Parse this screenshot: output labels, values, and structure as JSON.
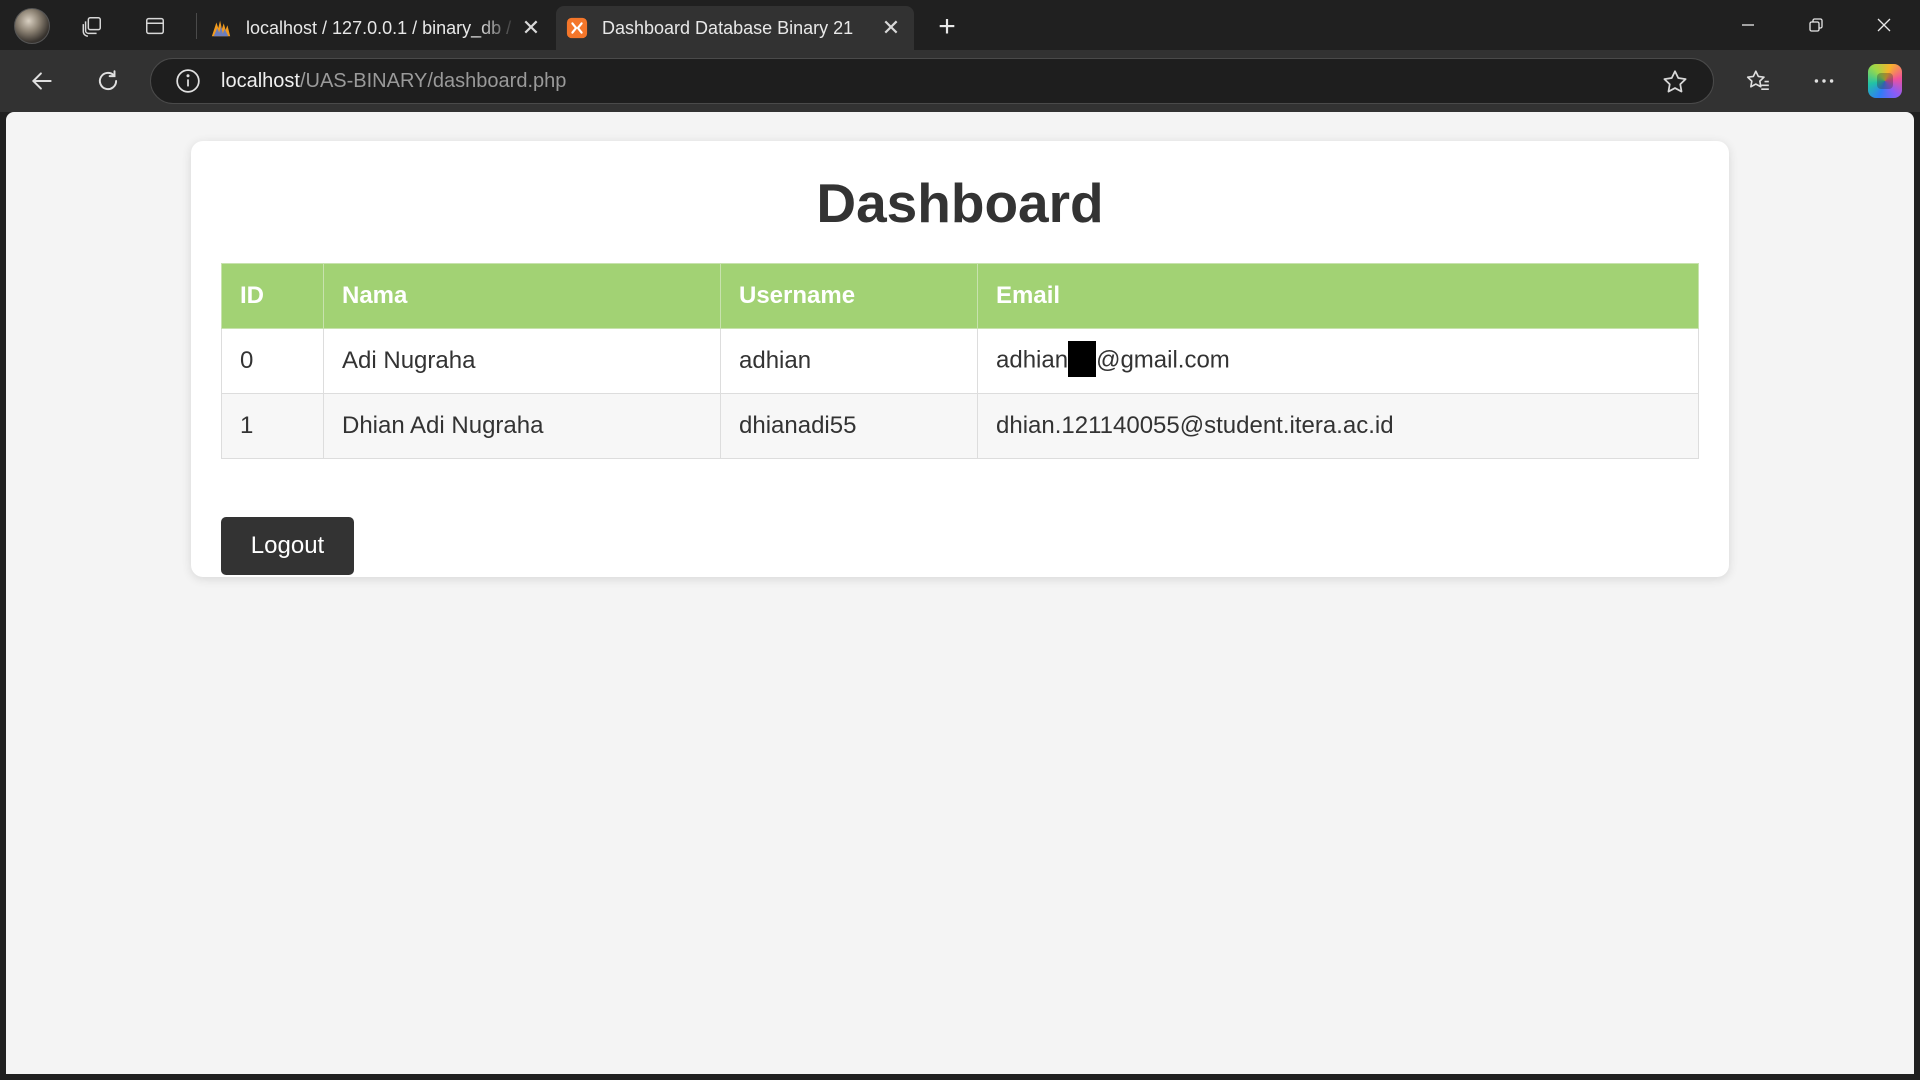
{
  "browser": {
    "tabs": [
      {
        "title": "localhost / 127.0.0.1 / binary_db / ",
        "active": false
      },
      {
        "title": "Dashboard Database Binary 21",
        "active": true
      }
    ],
    "address": {
      "host": "localhost",
      "path": "/UAS-BINARY/dashboard.php"
    },
    "icons": {
      "profile": "profile-avatar",
      "workspaces": "workspaces-icon",
      "tab_actions": "vertical-tabs-icon",
      "back": "back-arrow-icon",
      "refresh": "refresh-icon",
      "info": "info-icon",
      "favorite": "star-icon",
      "favorites": "favorites-icon",
      "more": "more-icon",
      "copilot": "copilot-icon"
    }
  },
  "page": {
    "title": "Dashboard",
    "table": {
      "columns": [
        "ID",
        "Nama",
        "Username",
        "Email"
      ],
      "rows": [
        {
          "id": "0",
          "nama": "Adi Nugraha",
          "username": "adhian",
          "email_prefix": "adhian",
          "email_suffix": "@gmail.com",
          "email_redacted": true
        },
        {
          "id": "1",
          "nama": "Dhian Adi Nugraha",
          "username": "dhianadi55",
          "email": "dhian.121140055@student.itera.ac.id"
        }
      ]
    },
    "logout_label": "Logout"
  },
  "colors": {
    "header_bg": "#a2d274",
    "button_bg": "#333333",
    "page_bg": "#f4f4f4"
  }
}
